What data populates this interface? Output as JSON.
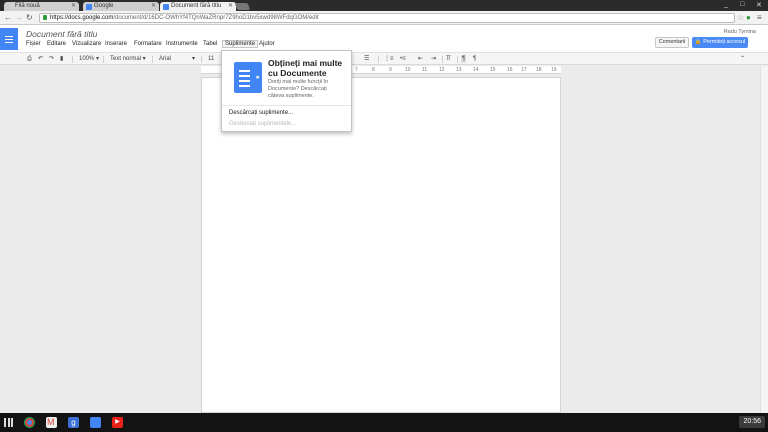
{
  "browser": {
    "tabs": [
      {
        "label": "Filă nouă",
        "active": false
      },
      {
        "label": "Google",
        "active": false
      },
      {
        "label": "Document fără titlu",
        "active": true
      }
    ],
    "url_host": "https://docs.google.com",
    "url_path": "/document/d/16DC-OWhYf4TQnWaZRnpr7Z9hoD1bv5xwd98WFdqGOM/edit",
    "window_controls": [
      "_",
      "□",
      "✕"
    ]
  },
  "docs": {
    "title": "Document fără titlu",
    "user": "Radu Tymina",
    "menus": [
      "Fișier",
      "Editare",
      "Vizualizare",
      "Inserare",
      "Formatare",
      "Instrumente",
      "Tabel",
      "Suplimente",
      "Ajutor"
    ],
    "comments_label": "Comentarii",
    "share_label": "Permiteți accesul"
  },
  "toolbar": {
    "zoom": "100%",
    "style": "Text normal",
    "font": "Arial",
    "size": "11"
  },
  "ruler": [
    "7",
    "8",
    "9",
    "10",
    "11",
    "12",
    "13",
    "14",
    "15",
    "16",
    "17",
    "18",
    "19"
  ],
  "addons_menu": {
    "promo_title": "Obțineți mai multe cu Documente",
    "promo_text": "Doriți mai multe funcții în Documente? Descărcați câteva suplimente.",
    "get_label": "Descărcați suplimente...",
    "manage_label": "Gestionați suplimentele..."
  },
  "taskbar": {
    "clock": "20:56"
  },
  "colors": {
    "accent": "#4285f4",
    "share": "#4a8af4"
  }
}
